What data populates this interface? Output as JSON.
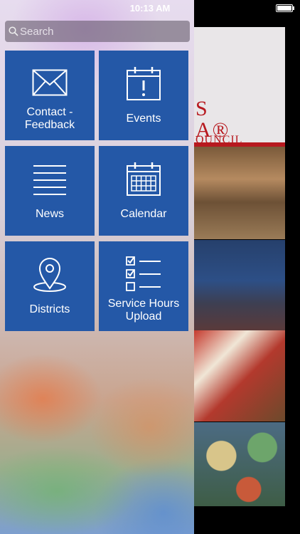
{
  "status_bar": {
    "time": "10:13 AM"
  },
  "search": {
    "placeholder": "Search"
  },
  "menu": {
    "contact_feedback": "Contact -\nFeedback",
    "events": "Events",
    "news": "News",
    "calendar": "Calendar",
    "districts": "Districts",
    "service_hours_upload": "Service Hours\nUpload"
  },
  "background_app": {
    "header_text": "S\nA®",
    "council_text": "OUNCIL"
  },
  "colors": {
    "tile": "#2458a7",
    "accent_red": "#b7191f"
  }
}
